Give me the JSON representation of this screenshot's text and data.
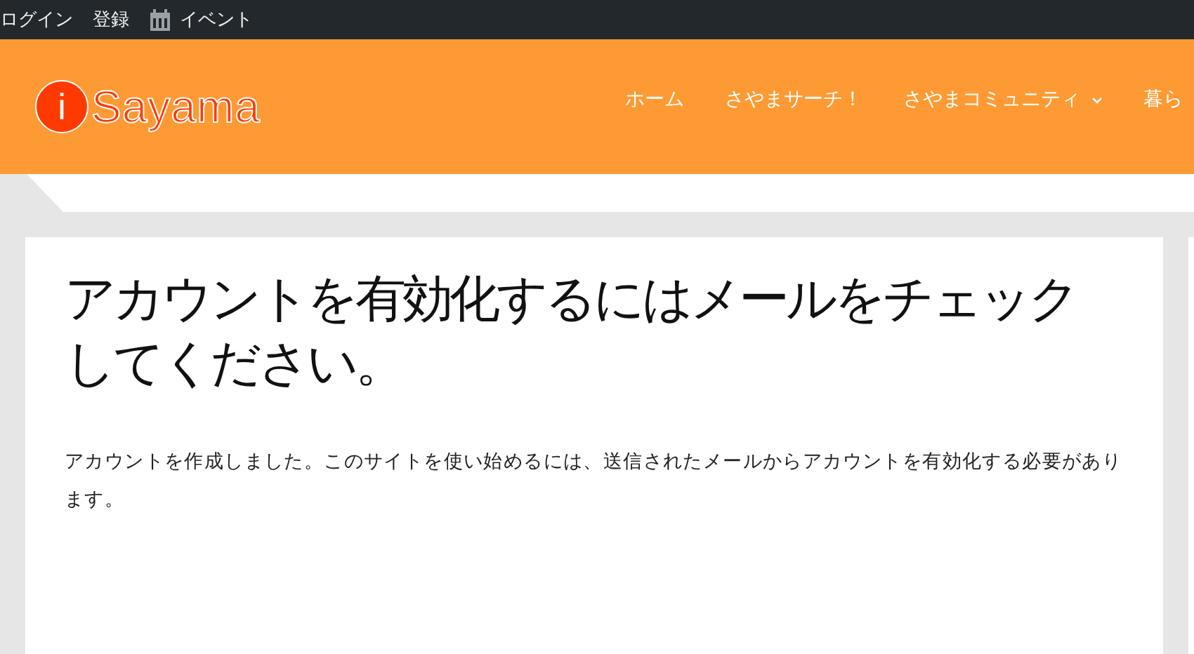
{
  "top_bar": {
    "links": [
      {
        "label": "ログイン",
        "kind": "text"
      },
      {
        "label": "登録",
        "kind": "text"
      },
      {
        "label": "イベント",
        "kind": "calendar"
      }
    ]
  },
  "header": {
    "logo": {
      "mark": "i",
      "text": "Sayama"
    },
    "nav": [
      {
        "label": "ホーム",
        "has_submenu": false
      },
      {
        "label": "さやまサーチ！",
        "has_submenu": false
      },
      {
        "label": "さやまコミュニティ",
        "has_submenu": true
      },
      {
        "label": "暮ら",
        "has_submenu": false
      }
    ]
  },
  "content": {
    "title": "アカウントを有効化するにはメールをチェックしてください。",
    "body": "アカウントを作成しました。このサイトを使い始めるには、送信されたメールからアカウントを有効化する必要があります。"
  }
}
